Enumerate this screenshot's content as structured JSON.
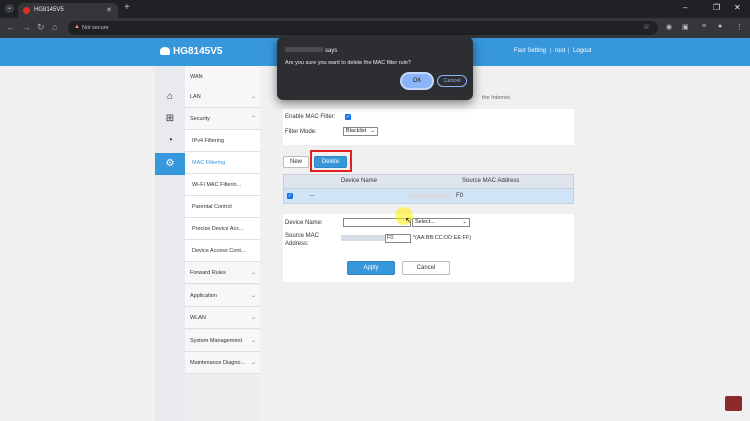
{
  "browser": {
    "tab_title": "HG8145V5",
    "security_label": "Not secure",
    "new_tab_icon": "+"
  },
  "router": {
    "brand": "HG8145V5",
    "fast_setting": "Fast Setting",
    "user": "root",
    "logout": "Logout"
  },
  "menu": {
    "wan": "WAN",
    "lan": "LAN",
    "security": "Security",
    "ipv4_filtering": "IPv4 Filtering",
    "mac_filtering": "MAC Filtering",
    "wifi_mac_filtering": "Wi-Fi MAC Filterin...",
    "parental_control": "Parental Control",
    "precise_device_access": "Precise Device Acc...",
    "device_access_control": "Device Access Cont...",
    "forward_rules": "Forward Rules",
    "application": "Application",
    "wlan": "WLAN",
    "system_management": "System Management",
    "maintenance_diagnosis": "Maintenance Diagno..."
  },
  "main": {
    "description_tail": "the Internet.",
    "enable_mac_filter_label": "Enable MAC Filter:",
    "filter_mode_label": "Filter Mode:",
    "filter_mode_value": "Blacklist",
    "new_button": "New",
    "delete_button": "Delete",
    "table": {
      "col_device_name": "Device Name",
      "col_source_mac": "Source MAC Address",
      "row_device_name": "--",
      "row_mac_tail": "F0"
    },
    "form": {
      "device_name_label": "Device Name:",
      "select_placeholder": "Select...",
      "source_mac_label_line1": "Source MAC",
      "source_mac_label_line2": "Address:",
      "mac_tail": "F0",
      "mac_format_hint": "*(AA:BB:CC:DD:EE:FF)"
    },
    "apply_button": "Apply",
    "cancel_button": "Cancel"
  },
  "dialog": {
    "title_suffix": "says",
    "message": "Are you sure you want to delete the MAC filter rule?",
    "ok_button": "OK",
    "cancel_button": "Cancel"
  }
}
